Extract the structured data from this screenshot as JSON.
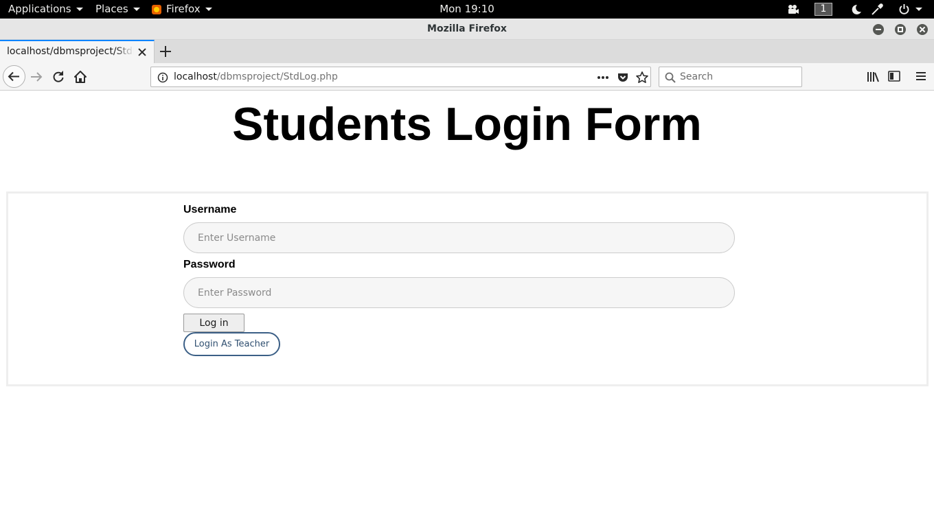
{
  "system_bar": {
    "applications_label": "Applications",
    "places_label": "Places",
    "firefox_label": "Firefox",
    "clock": "Mon 19:10",
    "workspace_number": "1"
  },
  "window": {
    "title": "Mozilla Firefox"
  },
  "tabs": [
    {
      "label": "localhost/dbmsproject/StdLog.php",
      "active": true
    }
  ],
  "navbar": {
    "url_host": "localhost",
    "url_path": "/dbmsproject/StdLog.php",
    "search_placeholder": "Search"
  },
  "page": {
    "heading": "Students Login Form",
    "username_label": "Username",
    "username_placeholder": "Enter Username",
    "password_label": "Password",
    "password_placeholder": "Enter Password",
    "login_button": "Log in",
    "teacher_button": "Login As Teacher"
  },
  "colors": {
    "tab_accent": "#0a84ff",
    "teacher_button_border": "#3b5f86"
  }
}
